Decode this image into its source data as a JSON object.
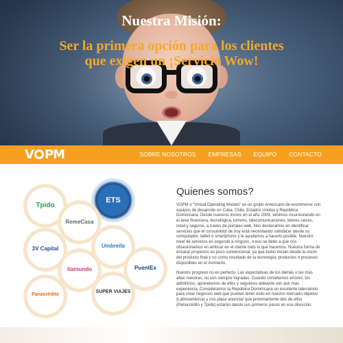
{
  "hero": {
    "title": "Nuestra Misión:",
    "subtitle": "Ser la primera opción para los clientes que exigen un ¡Servicio Wow!"
  },
  "nav": {
    "logo": "VOPM",
    "items": [
      "SOBRE NOSOTROS",
      "EMPRESAS",
      "EQUIPO",
      "CONTACTO"
    ]
  },
  "brands": {
    "tpido": "Tpido",
    "ets": "ETS",
    "remecasa": "RemeCasa",
    "umbrella": "Umbrella",
    "capital": "3V Capital",
    "puentex": "PuentEx",
    "tiamundo": "tiamundo",
    "panacredito": "Panacrédito",
    "superviajes": "SUPER VIAJES"
  },
  "about": {
    "title": "Quienes somos?",
    "p1": "VOPM o “Virtual Operating Models” es un grupo Americano de ecommerce con equipos de desarrollo en Cuba, Chile, Estados Unidos y República Dominicana. Desde nuestros inicios en el año 2009, venimos incursionando en el área financiera, tecnológica, turismo, telecomunicaciones, bienes raíces, retail y seguros, a través de portales web. Nos destacamos en identificar servicios que el consumidor de hoy está necesitando satisfacer desde su computador, tablet o smartphone y le ayudamos a hacerlo posible. Nuestro nivel de servicios es segundo a ninguno, o eso se debe a que nos obsesionamos en enfocar en el cliente todo lo que hacemos. Nuestra forma de encarar proyectos es poco convencional, ya que todos inician desde la visión del producto final y no como resultado de la tecnología, productos o procesos disponibles en el momento.",
    "p2": "Nuestro progreso no es perfecto. Las expectativas de los demás o las más altas nuestras, no son siempre logradas. Cuando cometemos errores, los admitimos, aprendemos de ellos y seguimos adelante con aun mas experiencia. Consideramos la República Dominicana un excelente laboratorio para crear negocios web que puedan tener éxito en nuestro mercado objetivo (Latinoamérica) y nos place anunciar que próximamente dos de ellos (Panacrédito y Tpido) estarán dando sus primeros pasos en esa dirección."
  },
  "colors": {
    "accent": "#f5a020",
    "gold_text": "#f3a829"
  }
}
